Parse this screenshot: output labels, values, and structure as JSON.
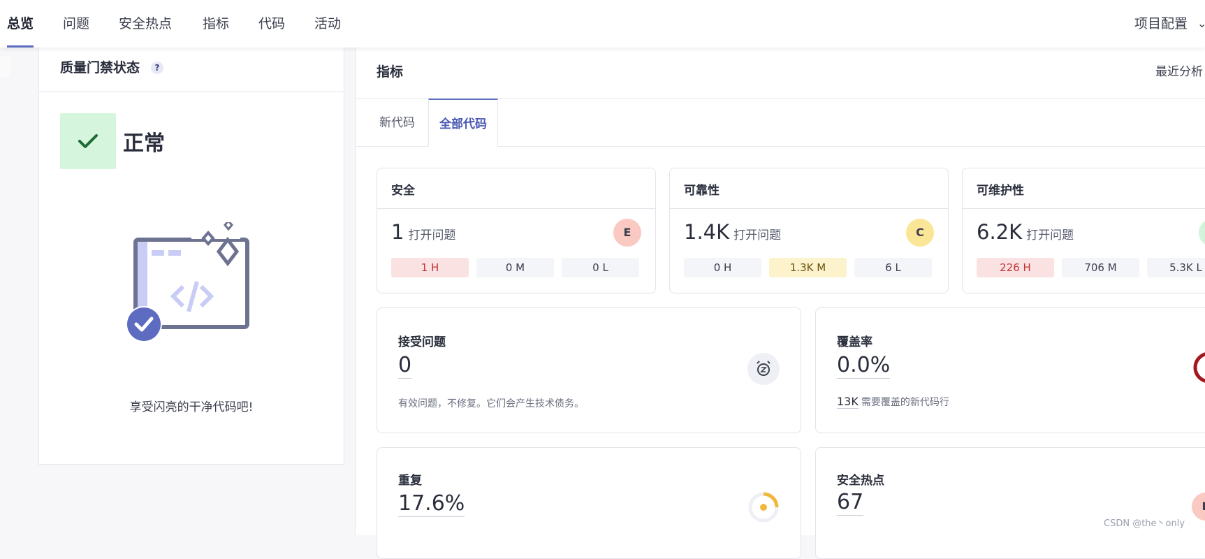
{
  "nav": {
    "tabs": [
      "总览",
      "问题",
      "安全热点",
      "指标",
      "代码",
      "活动"
    ],
    "active_index": 0,
    "project_config": "项目配置"
  },
  "quality_gate": {
    "title": "质量门禁状态",
    "help": "?",
    "status": "正常",
    "message": "享受闪亮的干净代码吧!"
  },
  "metrics": {
    "title": "指标",
    "recent_analysis": "最近分析",
    "tabs": [
      "新代码",
      "全部代码"
    ],
    "active_tab": 1,
    "cards": [
      {
        "title": "安全",
        "count": "1",
        "unit": "打开问题",
        "grade": "E",
        "grade_color": "#f9c9c2",
        "pills": [
          {
            "label": "1 H",
            "tone": "red"
          },
          {
            "label": "0 M",
            "tone": "neutral"
          },
          {
            "label": "0 L",
            "tone": "neutral"
          }
        ]
      },
      {
        "title": "可靠性",
        "count": "1.4K",
        "unit": "打开问题",
        "grade": "C",
        "grade_color": "#fbe597",
        "pills": [
          {
            "label": "0 H",
            "tone": "neutral"
          },
          {
            "label": "1.3K M",
            "tone": "yellow"
          },
          {
            "label": "6 L",
            "tone": "neutral"
          }
        ]
      },
      {
        "title": "可维护性",
        "count": "6.2K",
        "unit": "打开问题",
        "grade": "",
        "grade_color": "#d3f3da",
        "pills": [
          {
            "label": "226 H",
            "tone": "red"
          },
          {
            "label": "706 M",
            "tone": "neutral"
          },
          {
            "label": "5.3K L",
            "tone": "neutral"
          }
        ]
      }
    ],
    "accepted": {
      "title": "接受问题",
      "value": "0",
      "note": "有效问题，不修复。它们会产生技术债务。"
    },
    "coverage": {
      "title": "覆盖率",
      "value": "0.0%",
      "lines": "13K",
      "lines_note": "需要覆盖的新代码行"
    },
    "duplication": {
      "title": "重复",
      "value": "17.6%"
    },
    "hotspots": {
      "title": "安全热点",
      "value": "67",
      "grade": "E",
      "grade_color": "#f9c9c2"
    }
  },
  "watermark": "CSDN @the丶only"
}
